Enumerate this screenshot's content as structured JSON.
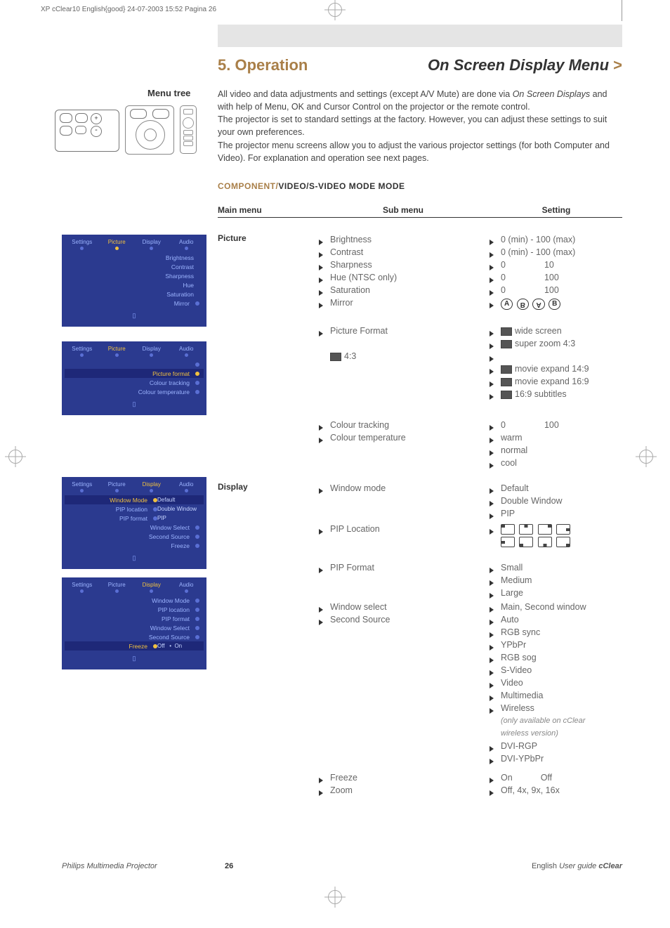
{
  "print_header": "XP cClear10 English{good} 24-07-2003 15:52 Pagina 26",
  "page_header": {
    "left": "5. Operation",
    "right": "On Screen Display Menu",
    "gt": ">"
  },
  "menu_tree_label": "Menu tree",
  "intro": {
    "p1a": "All video and data adjustments and settings (except A/V Mute) are done via ",
    "p1b": "On Screen Displays",
    "p1c": " and with help of Menu, OK and Cursor Control on the projector or the remote control.",
    "p2": "The projector is set to standard settings at the factory. However, you can adjust these settings to suit your own preferences.",
    "p3": "The projector menu screens allow you to adjust the various projector settings (for both Computer and Video). For explanation and operation see next pages."
  },
  "section": {
    "component_gold": "COMPONENT/",
    "component_rest": "VIDEO/S-VIDEO MODE MODE"
  },
  "table": {
    "main": "Main menu",
    "sub": "Sub menu",
    "setting": "Setting"
  },
  "main": {
    "picture": "Picture",
    "display": "Display"
  },
  "sub": {
    "brightness": "Brightness",
    "contrast": "Contrast",
    "sharpness": "Sharpness",
    "hue": "Hue (NTSC only)",
    "saturation": "Saturation",
    "mirror": "Mirror",
    "picture_format": "Picture Format",
    "fourthree": "4:3",
    "colour_tracking": "Colour tracking",
    "colour_temperature": "Colour temperature",
    "window_mode": "Window mode",
    "pip_location": "PIP Location",
    "pip_format": "PIP Format",
    "window_select": "Window select",
    "second_source": "Second Source",
    "freeze": "Freeze",
    "zoom": "Zoom"
  },
  "setting": {
    "r0_100": "0 (min) - 100 (max)",
    "r0_100b": "0 (min) - 100 (max)",
    "sharp_0": "0",
    "sharp_10": "10",
    "hue_0": "0",
    "hue_100": "100",
    "sat_0": "0",
    "sat_100": "100",
    "mirror_A": "A",
    "mirror_B": "B",
    "pf_wide": "wide screen",
    "pf_superzoom": "super zoom 4:3",
    "pf_149": "movie expand 14:9",
    "pf_169": "movie expand 16:9",
    "pf_169sub": "16:9 subtitles",
    "ct_0": "0",
    "ct_100": "100",
    "warm": "warm",
    "normal": "normal",
    "cool": "cool",
    "wm_default": "Default",
    "wm_double": "Double Window",
    "wm_pip": "PIP",
    "pf_small": "Small",
    "pf_medium": "Medium",
    "pf_large": "Large",
    "ws": "Main, Second window",
    "ss_auto": "Auto",
    "ss_rgbsync": "RGB sync",
    "ss_ypbpr": "YPbPr",
    "ss_rgbsog": "RGB sog",
    "ss_svideo": "S-Video",
    "ss_video": "Video",
    "ss_multimedia": "Multimedia",
    "ss_wireless": "Wireless",
    "ss_note1": "(only available on cClear",
    "ss_note2": "wireless version)",
    "ss_dvirgp": "DVI-RGP",
    "ss_dviypbpr": "DVI-YPbPr",
    "freeze_on": "On",
    "freeze_off": "Off",
    "zoom": "Off, 4x, 9x, 16x"
  },
  "osd": {
    "tabs": {
      "settings": "Settings",
      "picture": "Picture",
      "display": "Display",
      "audio": "Audio"
    },
    "p1": {
      "brightness": "Brightness",
      "contrast": "Contrast",
      "sharpness": "Sharpness",
      "hue": "Hue",
      "saturation": "Saturation",
      "mirror": "Mirror"
    },
    "p2": {
      "picture_format": "Picture format",
      "colour_tracking": "Colour tracking",
      "colour_temperature": "Colour temperature"
    },
    "p3": {
      "window_mode": "Window Mode",
      "pip_location": "PIP location",
      "pip_format": "PIP format",
      "window_select": "Window Select",
      "second_source": "Second Source",
      "freeze": "Freeze",
      "default": "Default",
      "double": "Double Window",
      "pip": "PIP"
    },
    "p4": {
      "window_mode": "Window Mode",
      "pip_location": "PIP location",
      "pip_format": "PIP format",
      "window_select": "Window Select",
      "second_source": "Second Source",
      "freeze": "Freeze",
      "off": "Off",
      "on": "On"
    }
  },
  "footer": {
    "left": "Philips Multimedia Projector",
    "page": "26",
    "right_lang": "English",
    "right_guide": "User guide",
    "right_model": "cClear"
  }
}
